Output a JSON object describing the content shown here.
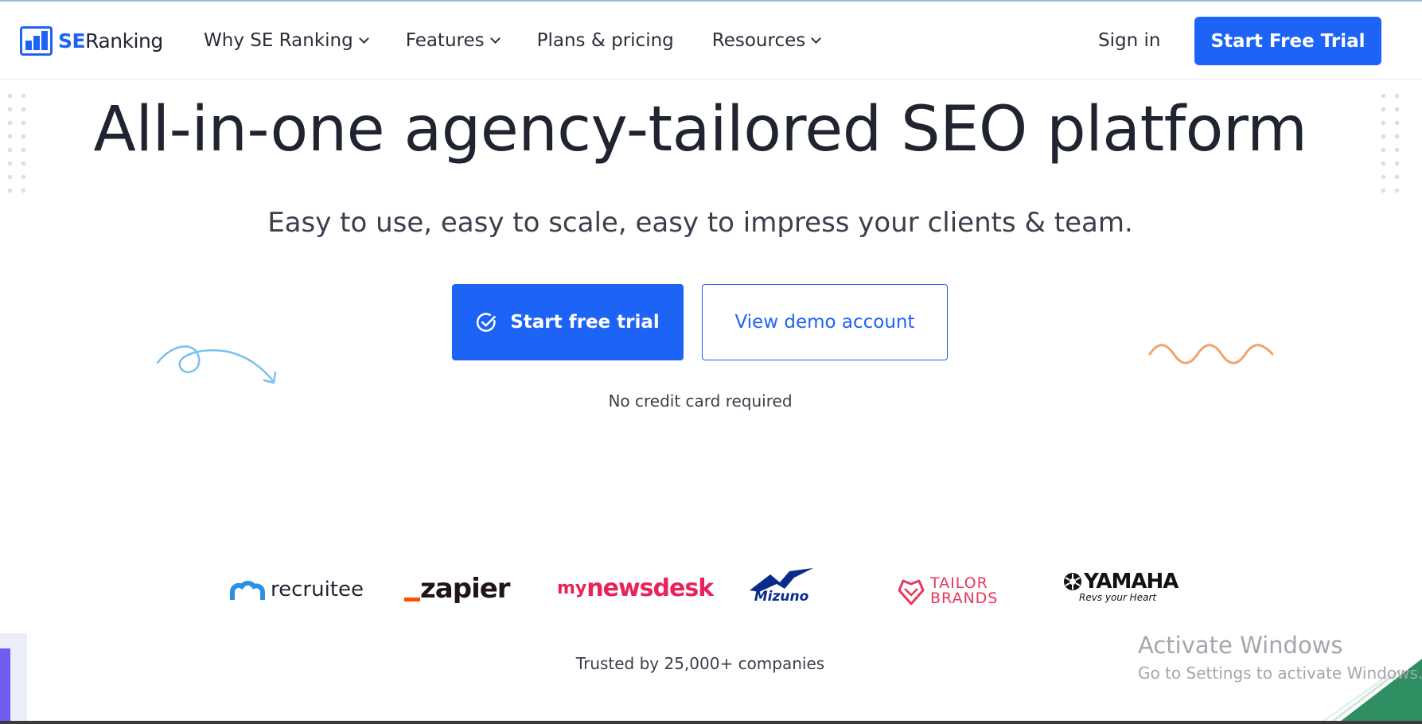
{
  "header": {
    "logo": {
      "se": "SE",
      "ranking": "Ranking"
    },
    "nav": [
      {
        "label": "Why SE Ranking",
        "has_dropdown": true
      },
      {
        "label": "Features",
        "has_dropdown": true
      },
      {
        "label": "Plans & pricing",
        "has_dropdown": false
      },
      {
        "label": "Resources",
        "has_dropdown": true
      }
    ],
    "sign_in": "Sign in",
    "cta": "Start Free Trial"
  },
  "hero": {
    "title": "All-in-one agency-tailored SEO platform",
    "subtitle": "Easy to use, easy to scale, easy to impress your clients & team.",
    "primary_button": "Start free trial",
    "secondary_button": "View demo account",
    "note": "No credit card required"
  },
  "brands": {
    "recruitee": "recruitee",
    "zapier": "zapier",
    "mynewsdesk_my": "my",
    "mynewsdesk_rest": "newsdesk",
    "mizuno": "Mizuno",
    "tailor_1": "TAILOR",
    "tailor_2": "BRANDS",
    "yamaha": "YAMAHA",
    "yamaha_tagline": "Revs your Heart"
  },
  "trusted": "Trusted by 25,000+ companies",
  "watermark": {
    "title": "Activate Windows",
    "subtitle": "Go to Settings to activate Windows."
  },
  "colors": {
    "primary": "#1d63f6",
    "text": "#1f2430",
    "arrow_deco": "#7cc0ee",
    "wave_deco": "#f4a36a",
    "newsdesk": "#e8235a",
    "tailor": "#e8385c",
    "zapier_accent": "#ff4f00"
  }
}
